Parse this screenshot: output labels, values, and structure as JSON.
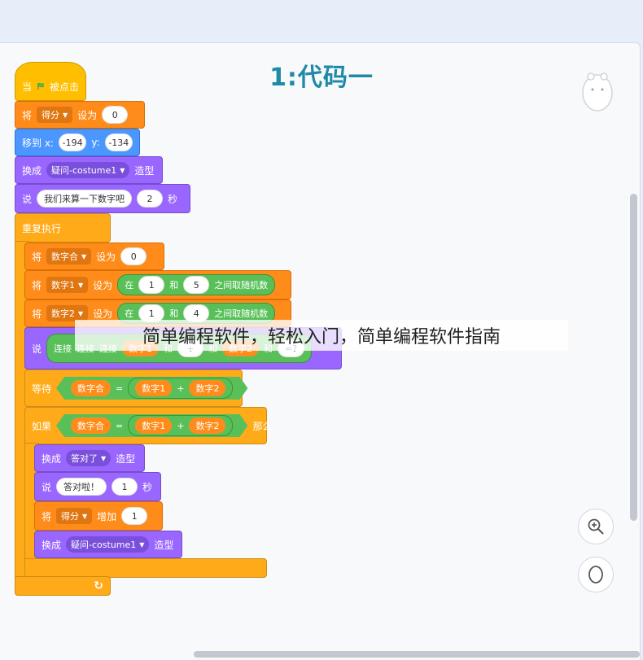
{
  "title": "1:代码一",
  "watermark": "简单编程软件，轻松入门，简单编程软件指南",
  "blocks": {
    "hat": {
      "when": "当",
      "clicked": "被点击"
    },
    "set_score": {
      "label": "将",
      "var": "得分",
      "to": "设为",
      "value": "0"
    },
    "goto": {
      "label": "移到 x:",
      "x": "-194",
      "ylabel": "y:",
      "y": "-134"
    },
    "costume1": {
      "label": "换成",
      "costume": "疑问-costume1",
      "suffix": "造型"
    },
    "say1": {
      "label": "说",
      "text": "我们来算一下数字吧",
      "secs": "2",
      "unit": "秒"
    },
    "forever": {
      "label": "重复执行"
    },
    "set_sum": {
      "label": "将",
      "var": "数字合",
      "to": "设为",
      "value": "0"
    },
    "set_n1": {
      "label": "将",
      "var": "数字1",
      "to": "设为",
      "in": "在",
      "from": "1",
      "and": "和",
      "max": "5",
      "suffix": "之间取随机数"
    },
    "set_n2": {
      "label": "将",
      "var": "数字2",
      "to": "设为",
      "in": "在",
      "from": "1",
      "and": "和",
      "max": "4",
      "suffix": "之间取随机数"
    },
    "say_join": {
      "label": "说",
      "join": "连接",
      "plus": "+",
      "and": "和",
      "eq": "=?"
    },
    "wait": {
      "label": "等待",
      "sum": "数字合",
      "equals": "=",
      "n1": "数字1",
      "plus": "+",
      "n2": "数字2"
    },
    "if": {
      "label": "如果",
      "sum": "数字合",
      "equals": "=",
      "n1": "数字1",
      "plus": "+",
      "n2": "数字2",
      "then": "那么"
    },
    "costume2": {
      "label": "换成",
      "costume": "答对了",
      "suffix": "造型"
    },
    "say2": {
      "label": "说",
      "text": "答对啦！",
      "secs": "1",
      "unit": "秒"
    },
    "change": {
      "label": "将",
      "var": "得分",
      "by": "增加",
      "value": "1"
    },
    "costume3": {
      "label": "换成",
      "costume": "疑问-costume1",
      "suffix": "造型"
    },
    "loop_arrow": "↻"
  },
  "icons": {
    "flag": "green-flag-icon",
    "zoom_in": "zoom-in-icon",
    "reset": "zoom-reset-icon",
    "sprite": "sprite-thumbnail"
  },
  "colors": {
    "events": "#ffbf00",
    "variables": "#ff8c1a",
    "motion": "#4c97ff",
    "looks": "#9966ff",
    "control": "#ffab19",
    "operators": "#59c059",
    "title": "#1f8aa7"
  }
}
